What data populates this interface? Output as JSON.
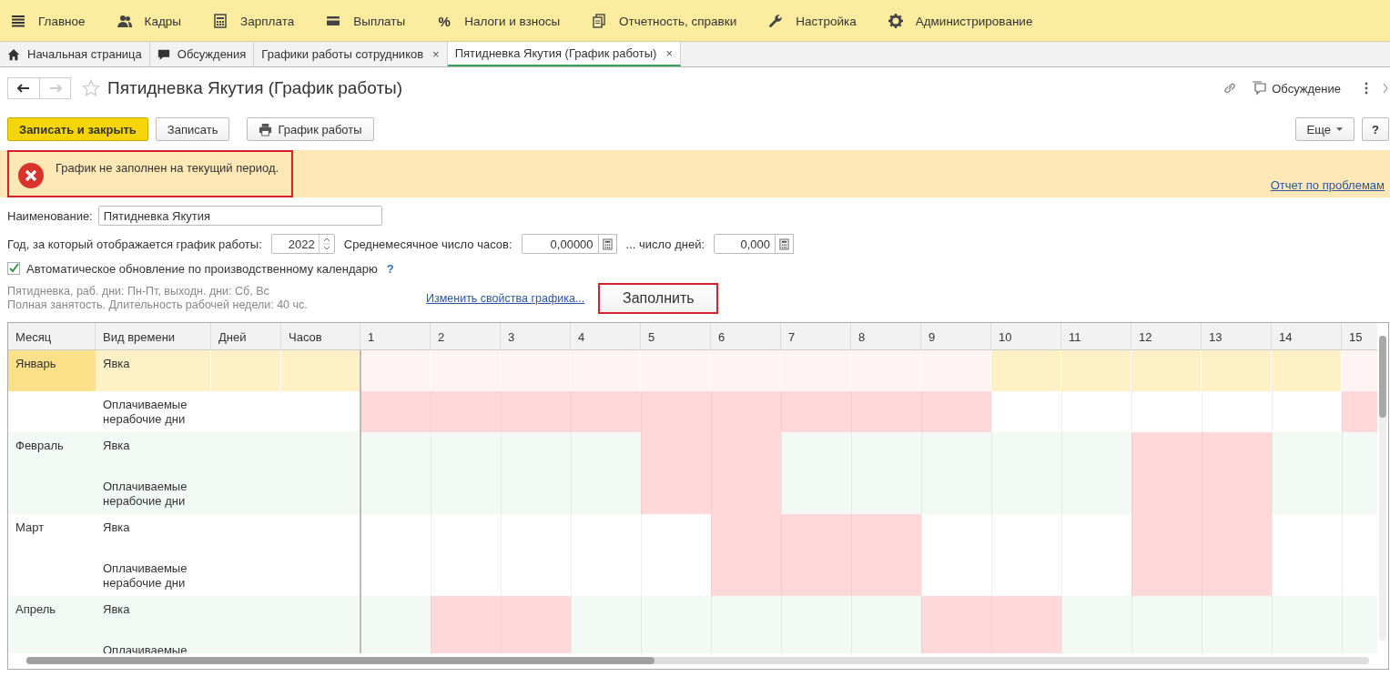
{
  "menu": [
    {
      "label": "Главное"
    },
    {
      "label": "Кадры"
    },
    {
      "label": "Зарплата"
    },
    {
      "label": "Выплаты"
    },
    {
      "label": "Налоги и взносы",
      "symbol": "%"
    },
    {
      "label": "Отчетность, справки"
    },
    {
      "label": "Настройка"
    },
    {
      "label": "Администрирование"
    }
  ],
  "tabs": [
    {
      "label": "Начальная страница",
      "selected": false
    },
    {
      "label": "Обсуждения",
      "selected": false
    },
    {
      "label": "Графики работы сотрудников",
      "selected": false,
      "close": "×"
    },
    {
      "label": "Пятидневка Якутия (График работы)",
      "selected": true,
      "close": "×"
    }
  ],
  "title": "Пятидневка Якутия (График работы)",
  "discussion": "Обсуждение",
  "toolbar": [
    {
      "label": "Записать и закрыть",
      "kind": "primary"
    },
    {
      "label": "Записать",
      "kind": "plain"
    },
    {
      "label": "График работы",
      "kind": "print"
    }
  ],
  "more": "Еще",
  "help": "?",
  "message": {
    "text": "График не заполнен на текущий период.",
    "highlighted": true,
    "link": "Отчет по проблемам"
  },
  "name": {
    "label": "Наименование:",
    "value": "Пятидневка Якутия"
  },
  "year": {
    "label": "Год, за который отображается график работы:",
    "value": "2022"
  },
  "avg_hours": {
    "label": "Среднемесячное число часов:",
    "value": "0,00000"
  },
  "avg_days": {
    "label": "... число дней:",
    "value": "0,000"
  },
  "auto_update": {
    "label": "Автоматическое обновление по производственному календарю",
    "checked": true,
    "help": "?"
  },
  "description": [
    "Пятидневка, раб. дни: Пн-Пт, выходн. дни: Сб, Вс",
    "Полная занятость. Длительность рабочей недели: 40 чс."
  ],
  "change_link": "Изменить свойства графика...",
  "fill_button": {
    "label": "Заполнить",
    "highlighted": true
  },
  "table": {
    "columns": [
      "Месяц",
      "Вид времени",
      "Дней",
      "Часов",
      "1",
      "2",
      "3",
      "4",
      "5",
      "6",
      "7",
      "8",
      "9",
      "10",
      "11",
      "12",
      "13",
      "14",
      "15"
    ],
    "months": [
      {
        "month": "Январь",
        "selected": true,
        "rows": [
          "Явка",
          "Оплачиваемые нерабочие дни"
        ],
        "off": [
          true,
          true,
          true,
          true,
          true,
          true,
          true,
          true,
          true,
          false,
          false,
          false,
          false,
          false,
          true
        ]
      },
      {
        "month": "Февраль",
        "selected": false,
        "rows": [
          "Явка",
          "Оплачиваемые нерабочие дни"
        ],
        "off": [
          false,
          false,
          false,
          false,
          true,
          true,
          false,
          false,
          false,
          false,
          false,
          true,
          true,
          false,
          false
        ]
      },
      {
        "month": "Март",
        "selected": false,
        "rows": [
          "Явка",
          "Оплачиваемые нерабочие дни"
        ],
        "off": [
          false,
          false,
          false,
          false,
          false,
          true,
          true,
          true,
          false,
          false,
          false,
          true,
          true,
          false,
          false
        ]
      },
      {
        "month": "Апрель",
        "selected": false,
        "rows": [
          "Явка",
          "Оплачиваемые"
        ],
        "off": [
          false,
          true,
          true,
          false,
          false,
          false,
          false,
          false,
          true,
          true,
          false,
          false,
          false,
          false,
          false
        ]
      }
    ]
  }
}
